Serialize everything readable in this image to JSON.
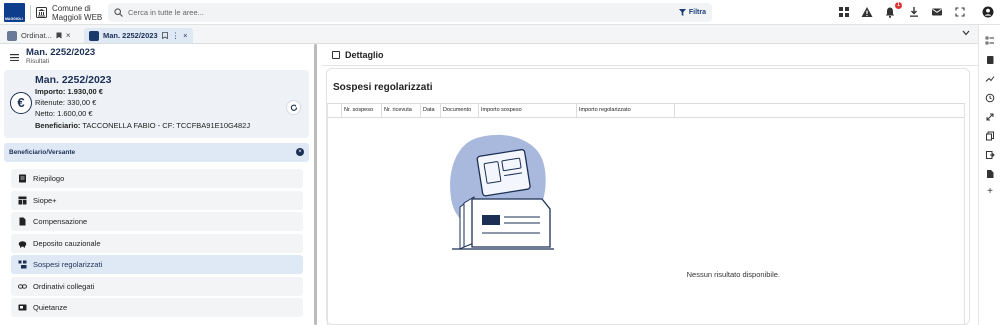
{
  "app": {
    "logo_text": "MAGGIOLI",
    "name": "Comune di Maggioli WEB"
  },
  "search": {
    "placeholder": "Cerca in tutte le aree...",
    "filter_label": "Filtra"
  },
  "topbar": {
    "notification_count": "1",
    "icons": [
      "grid-icon",
      "warning-icon",
      "bell-icon",
      "download-icon",
      "mail-icon",
      "fullscreen-icon",
      "account-icon"
    ]
  },
  "tabs": [
    {
      "label": "Ordinat...",
      "active": false
    },
    {
      "label": "Man. 2252/2023",
      "active": true
    }
  ],
  "left": {
    "title": "Man. 2252/2023",
    "subtitle": "Risultati",
    "card": {
      "title": "Man. 2252/2023",
      "importo": "Importo: 1.930,00 €",
      "ritenute": "Ritenute: 330,00 €",
      "netto": "Netto: 1.600,00 €",
      "beneficiario_label": "Beneficiario:",
      "beneficiario_value": "TACCONELLA FABIO - CF: TCCFBA91E10G482J"
    },
    "section_label": "Beneficiario/Versante",
    "nav": [
      {
        "label": "Riepilogo",
        "icon": "summary-icon",
        "active": false
      },
      {
        "label": "Siope+",
        "icon": "table-icon",
        "active": false
      },
      {
        "label": "Compensazione",
        "icon": "document-icon",
        "active": false
      },
      {
        "label": "Deposito cauzionale",
        "icon": "piggy-bank-icon",
        "active": false
      },
      {
        "label": "Sospesi regolarizzati",
        "icon": "reconcile-icon",
        "active": true
      },
      {
        "label": "Ordinativi collegati",
        "icon": "link-icon",
        "active": false
      },
      {
        "label": "Quietanze",
        "icon": "receipt-icon",
        "active": false
      }
    ]
  },
  "detail": {
    "header": "Dettaglio",
    "title": "Sospesi regolarizzati",
    "columns": [
      "Nr. sospeso",
      "Nr. ricevuta",
      "Data",
      "Documento",
      "Importo sospeso",
      "Importo regolarizzato"
    ],
    "empty_message": "Nessun risultato disponibile."
  },
  "colors": {
    "primary": "#1b2f55",
    "accent_bg": "#dfe9f6",
    "card_bg": "#eef1f5",
    "illustration": "#a9b9dd"
  }
}
